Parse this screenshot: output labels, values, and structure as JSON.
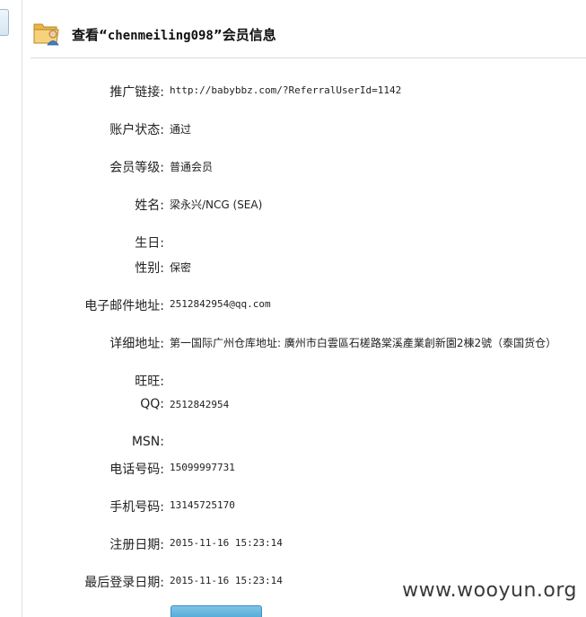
{
  "header": {
    "title_prefix": "查看“",
    "username": "chenmeiling098",
    "title_suffix": "”会员信息",
    "icon": "folder-user-icon"
  },
  "fields": [
    {
      "label": "推广链接:",
      "value": "http://babybbz.com/?ReferralUserId=1142",
      "mono": true
    },
    {
      "label": "账户状态:",
      "value": "通过",
      "mono": false
    },
    {
      "label": "会员等级:",
      "value": "普通会员",
      "mono": false
    },
    {
      "label": "姓名:",
      "value": "梁永兴/NCG (SEA)",
      "mono": false
    },
    {
      "label": "生日:",
      "value": "",
      "mono": false
    },
    {
      "label": "性别:",
      "value": "保密",
      "mono": false
    },
    {
      "label": "电子邮件地址:",
      "value": "2512842954@qq.com",
      "mono": true
    },
    {
      "label": "详细地址:",
      "value": "第一国际广州仓库地址: 廣州市白雲區石槎路棠溪產業創新園2棟2號（泰国货仓）",
      "mono": false
    },
    {
      "label": "旺旺:",
      "value": "",
      "mono": false
    },
    {
      "label": "QQ:",
      "value": "2512842954",
      "mono": true
    },
    {
      "label": "MSN:",
      "value": "",
      "mono": true
    },
    {
      "label": "电话号码:",
      "value": "15099997731",
      "mono": true
    },
    {
      "label": "手机号码:",
      "value": "13145725170",
      "mono": true
    },
    {
      "label": "注册日期:",
      "value": "2015-11-16 15:23:14",
      "mono": true
    },
    {
      "label": "最后登录日期:",
      "value": "2015-11-16 15:23:14",
      "mono": true
    }
  ],
  "watermark": "www.wooyun.org",
  "colors": {
    "button": "#3c9ed0",
    "divider": "#dcdcdc"
  }
}
